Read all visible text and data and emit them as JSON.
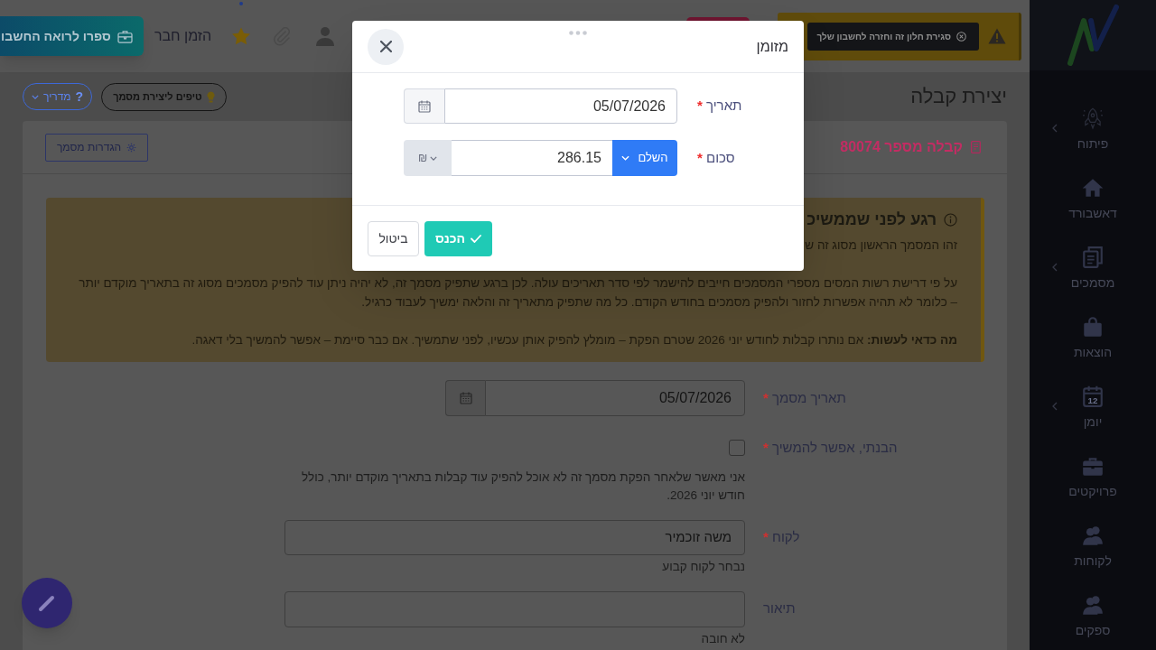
{
  "top_bar": {
    "notice": {
      "close_button": "סגירת חלון זה וחזרה לחשבון שלך"
    },
    "invite_link": "הזמן חבר",
    "accountant_button": "ספרו לרואה החשבו"
  },
  "sidebar": {
    "items": [
      {
        "label": "פיתוח",
        "has_submenu": true
      },
      {
        "label": "דאשבורד",
        "has_submenu": false
      },
      {
        "label": "מסמכים",
        "has_submenu": true
      },
      {
        "label": "הוצאות",
        "has_submenu": false
      },
      {
        "label": "יומן",
        "has_submenu": true,
        "icon_text": "12"
      },
      {
        "label": "פרויקטים",
        "has_submenu": false
      },
      {
        "label": "לקוחות",
        "has_submenu": false
      },
      {
        "label": "ספקים",
        "has_submenu": false
      }
    ]
  },
  "page_header": {
    "title": "יצירת קבלה",
    "tips_button": "טיפים ליצירת מסמך",
    "guide_button": {
      "mark": "?",
      "label": "מדריך"
    }
  },
  "document": {
    "title": "קבלה מספר 80074",
    "settings_button": "הגדרות מסמך"
  },
  "alert": {
    "title": "רגע לפני שממשיכ",
    "paragraphs": [
      "זהו המסמך הראשון מסוג זה ש",
      "על פי דרישת רשות המסים מספרי המסמכים חייבים להישמר לפי סדר תאריכים עולה. לכן ברגע שתפיק מסמך זה, לא יהיה ניתן עוד להפיק מסמכים מסוג זה בתאריך מוקדם יותר – כלומר לא תהיה אפשרות לחזור ולהפיק מסמכים בחודש הקודם. כל מה שתפיק מתאריך זה והלאה ימשיך לעבוד כרגיל.",
      "**מה כדאי לעשות:** אם נותרו קבלות לחודש יוני 2026 שטרם הפקת – מומלץ להפיק אותן עכשיו, לפני שתמשיך. אם כבר סיימת – אפשר להמשיך בלי דאגה."
    ]
  },
  "form": {
    "fields": [
      {
        "kind": "date",
        "label": "תאריך מסמך",
        "required_mark": "*",
        "value": "05/07/2026"
      },
      {
        "kind": "checkbox",
        "label": "הבנתי, אפשר להמשיך",
        "required_mark": "*",
        "checked": false,
        "help": "אני מאשר שלאחר הפקת מסמך זה לא אוכל להפיק עוד קבלות בתאריך מוקדם יותר, כולל חודש יוני 2026."
      },
      {
        "kind": "text",
        "label": "לקוח",
        "required_mark": "*",
        "value": "משה זוכמיר",
        "help": "נבחר לקוח קבוע"
      },
      {
        "kind": "text",
        "label": "תיאור",
        "help": "לא חובה"
      }
    ]
  },
  "modal": {
    "title": "מזומן",
    "fields": [
      {
        "kind": "date",
        "label": "תאריך",
        "required_mark": "*",
        "value": "05/07/2026"
      },
      {
        "kind": "amount",
        "label": "סכום",
        "required_mark": "*",
        "complete_button": "השלם",
        "value": "286.15",
        "currency": "₪"
      }
    ],
    "buttons": [
      {
        "kind": "primary",
        "label": "הכנס"
      },
      {
        "kind": "secondary",
        "label": "ביטול"
      }
    ]
  }
}
